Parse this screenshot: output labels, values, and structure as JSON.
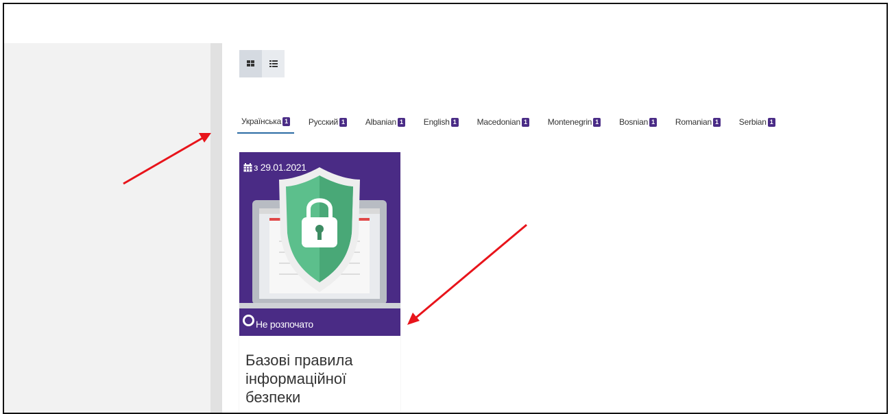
{
  "view_toggle": {
    "grid_icon": "grid-view-icon",
    "list_icon": "list-view-icon"
  },
  "tabs": [
    {
      "label": "Українська",
      "count": "1",
      "active": true
    },
    {
      "label": "Русский",
      "count": "1"
    },
    {
      "label": "Albanian",
      "count": "1"
    },
    {
      "label": "English",
      "count": "1"
    },
    {
      "label": "Macedonian",
      "count": "1"
    },
    {
      "label": "Montenegrin",
      "count": "1"
    },
    {
      "label": "Bosnian",
      "count": "1"
    },
    {
      "label": "Romanian",
      "count": "1"
    },
    {
      "label": "Serbian",
      "count": "1"
    }
  ],
  "card": {
    "date": "з 29.01.2021",
    "date_icon": "calendar-icon",
    "status": "Не розпочато",
    "title_lines": [
      "Базові правила",
      "інформаційної",
      "безпеки"
    ]
  },
  "colors": {
    "card_bg": "#4a2b85",
    "badge_bg": "#4a2c86",
    "active_tab_underline": "#2a6aa3",
    "shield": "#5cbf8c",
    "annotation_arrow": "#e8141b"
  }
}
